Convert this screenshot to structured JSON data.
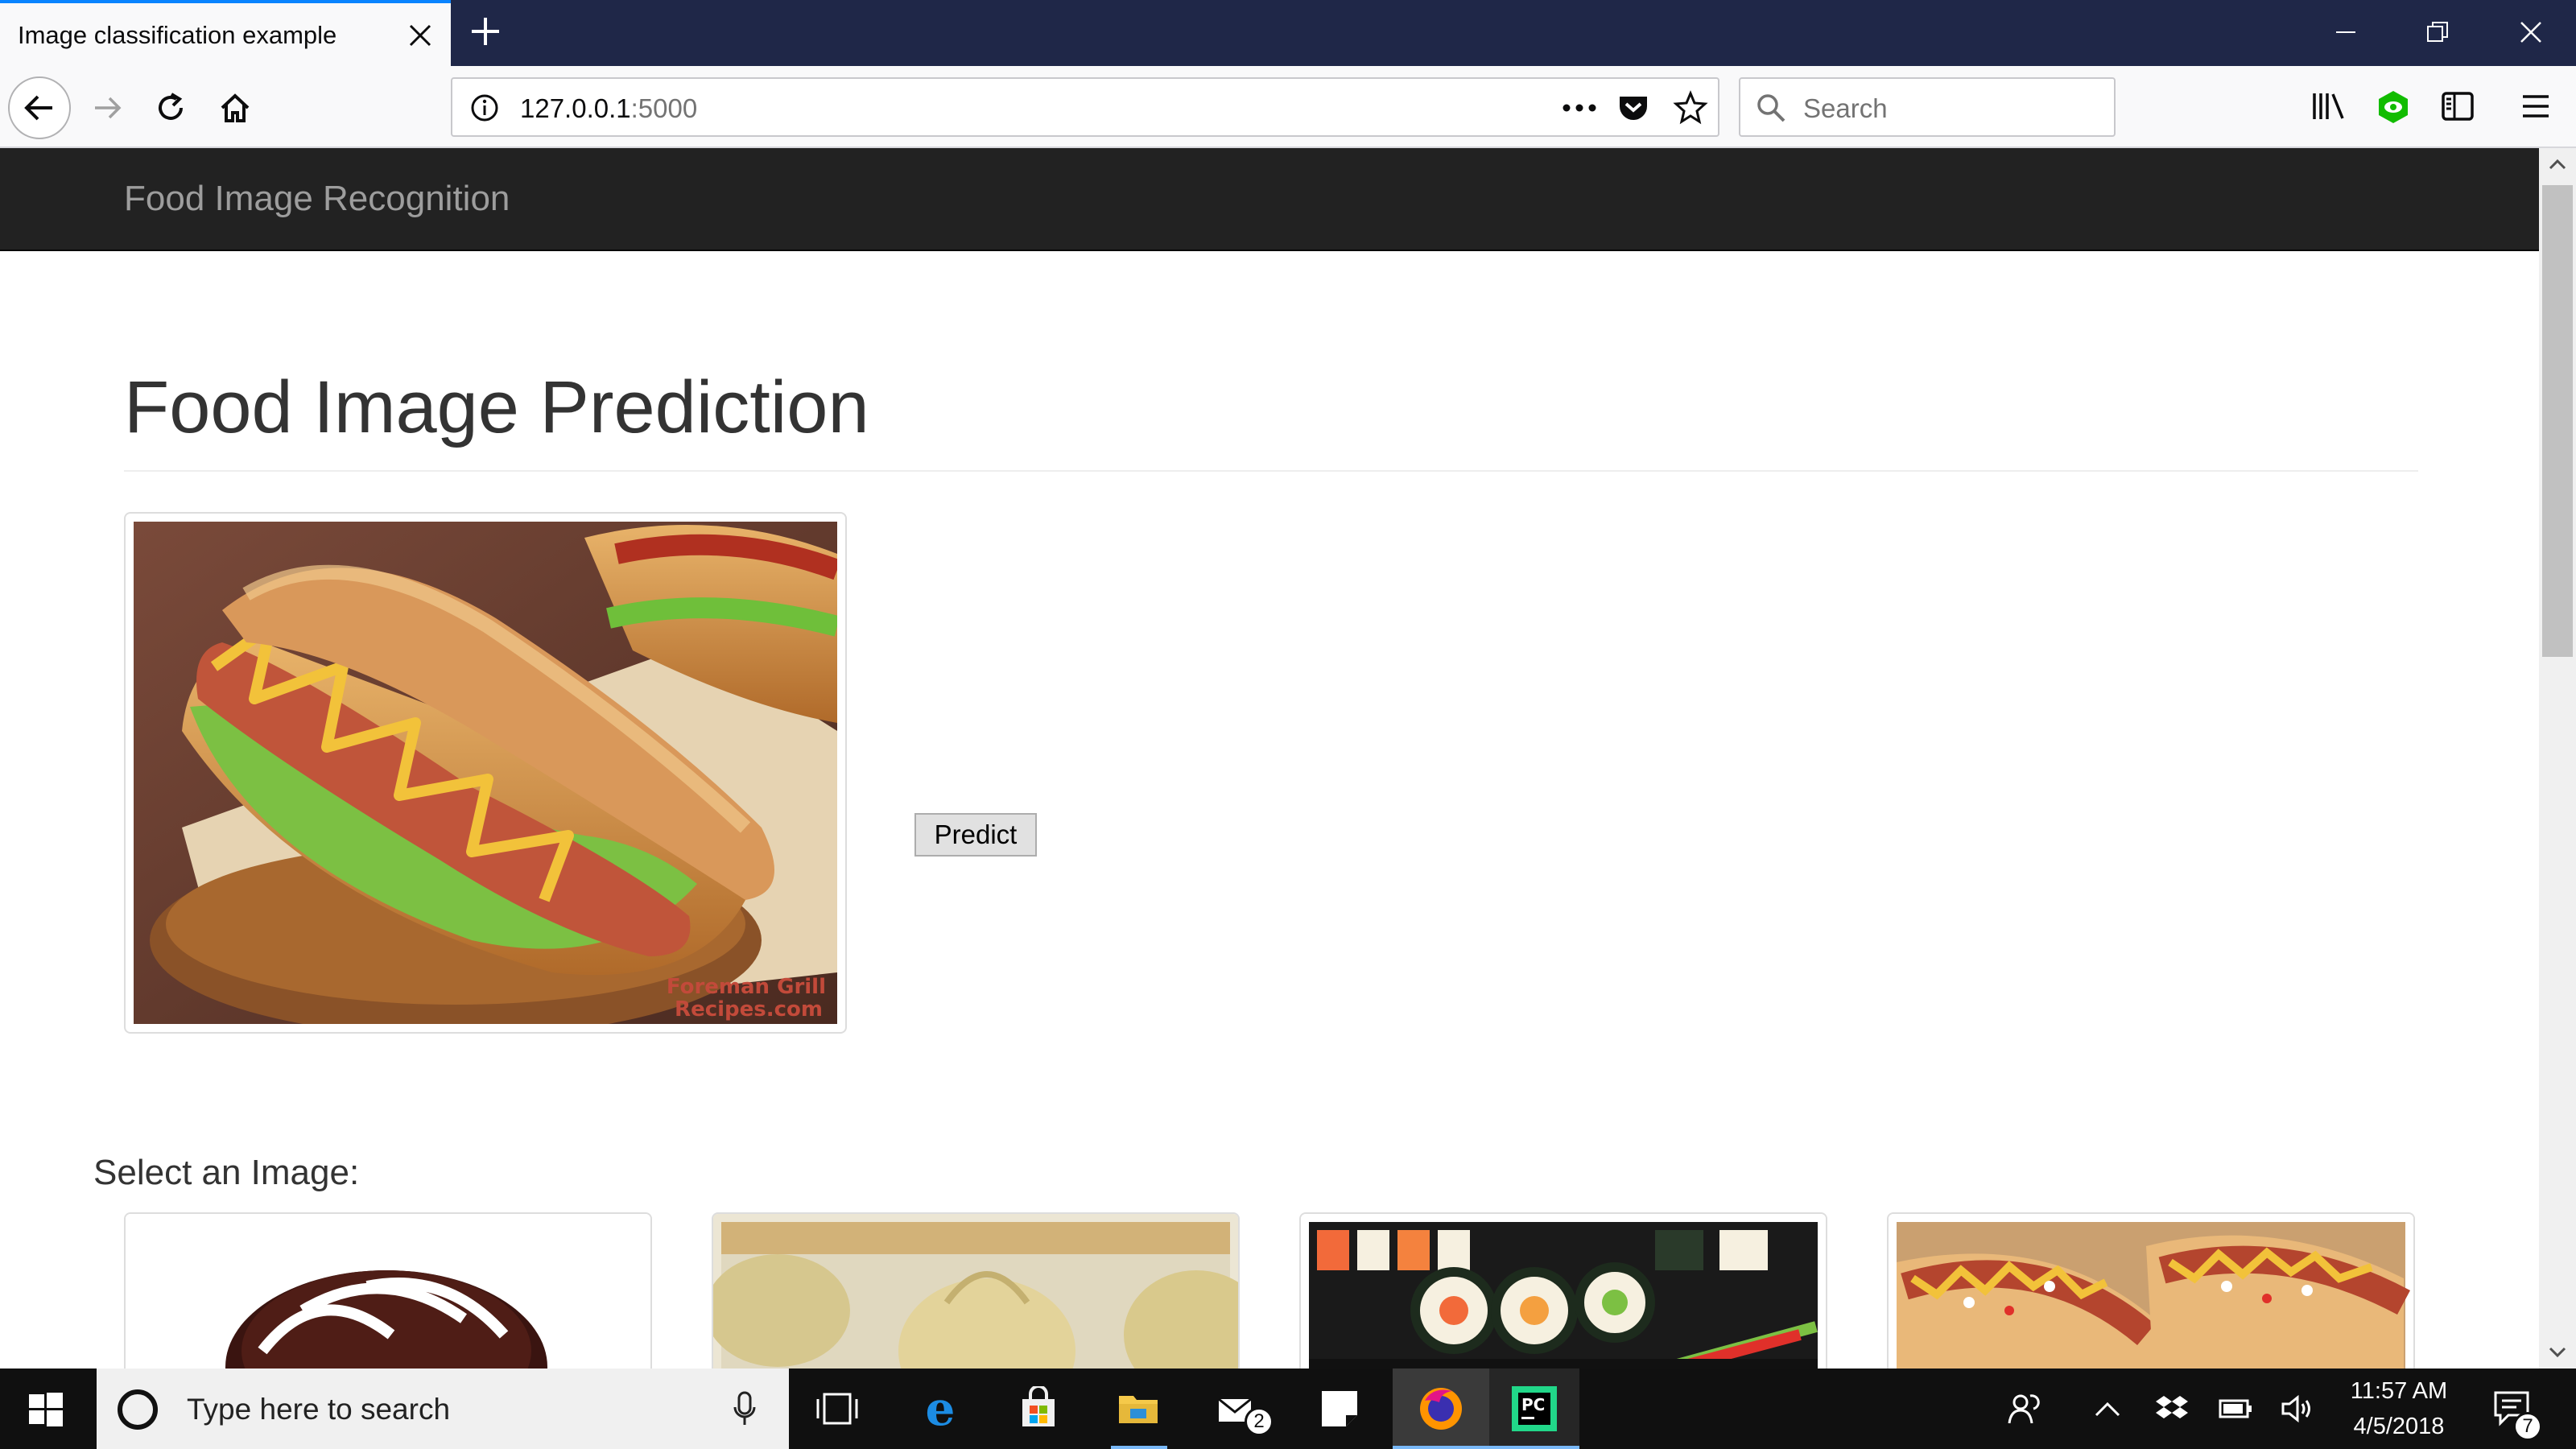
{
  "browser": {
    "tab_title": "Image classification example",
    "url_host": "127.0.0.1",
    "url_port": ":5000",
    "search_placeholder": "Search"
  },
  "site": {
    "brand": "Food Image Recognition",
    "page_title": "Food Image Prediction",
    "predict_label": "Predict",
    "select_label": "Select an Image:",
    "watermark_line1": "Foreman Grill",
    "watermark_line2": "Recipes.com"
  },
  "taskbar": {
    "search_placeholder": "Type here to search",
    "mail_badge": "2",
    "clock_time": "11:57 AM",
    "clock_date": "4/5/2018",
    "notification_badge": "7"
  },
  "colors": {
    "tab_strip": "#1f2748",
    "accent": "#0a84ff",
    "site_navbar": "#222222",
    "brand_text": "#9d9d9d",
    "taskbar": "#101010"
  }
}
